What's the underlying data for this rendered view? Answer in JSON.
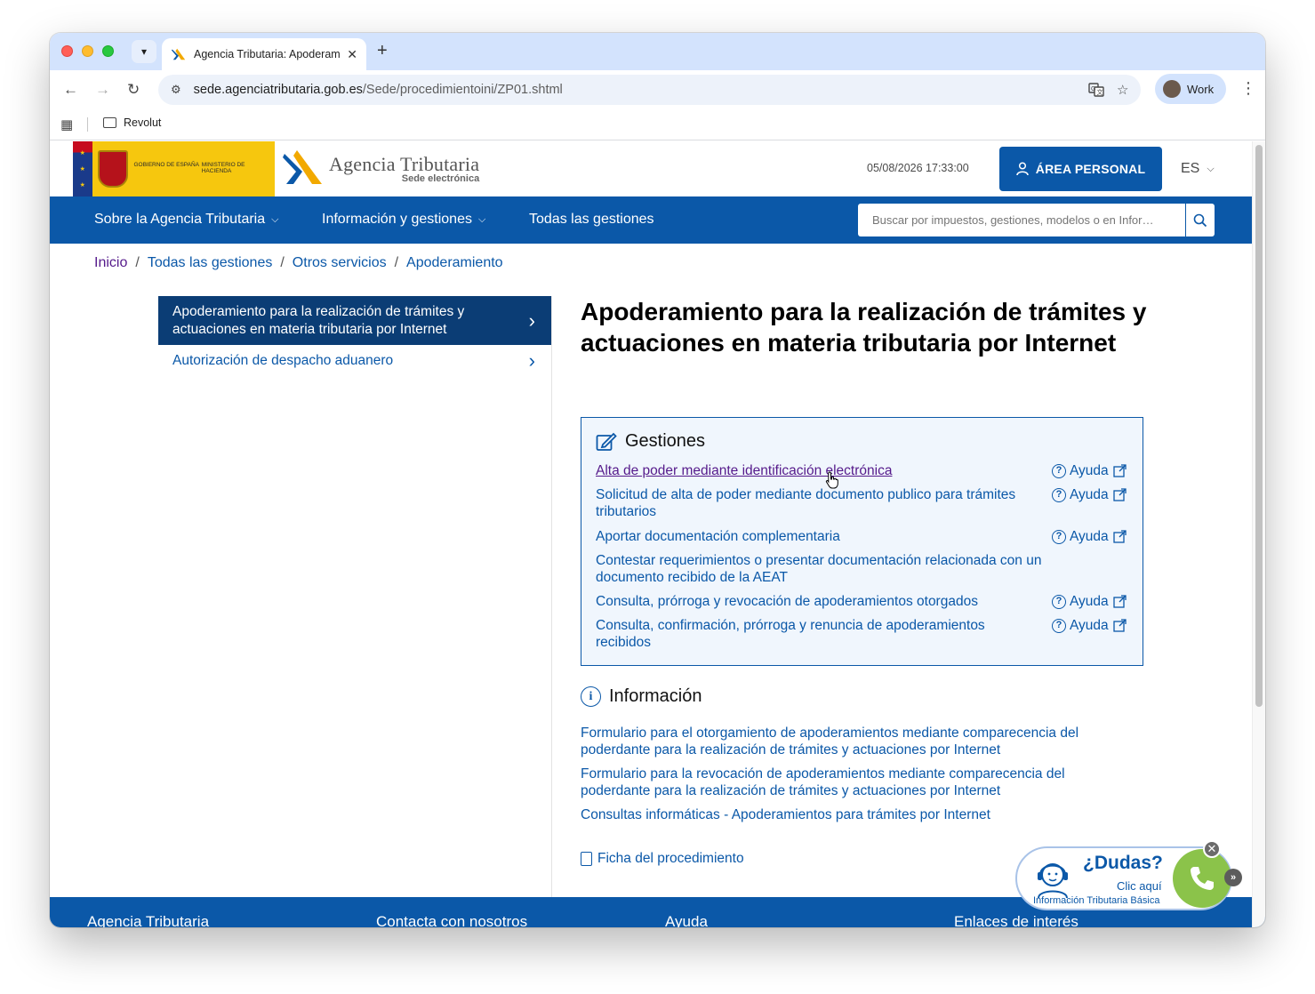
{
  "browser": {
    "tab_title": "Agencia Tributaria: Apoderam",
    "url_domain": "sede.agenciatributaria.gob.es",
    "url_path": "/Sede/procedimientoini/ZP01.shtml",
    "profile_label": "Work",
    "bookmark_folder": "Revolut"
  },
  "header": {
    "gov_text_1": "Gobierno de España",
    "gov_text_2": "Ministerio de Hacienda",
    "brand_name": "Agencia Tributaria",
    "brand_sub": "Sede electrónica",
    "datetime": "05/08/2026 17:33:00",
    "area_personal": "ÁREA PERSONAL",
    "lang": "ES"
  },
  "nav": {
    "items": [
      "Sobre la Agencia Tributaria",
      "Información y gestiones",
      "Todas las gestiones"
    ],
    "search_placeholder": "Buscar por impuestos, gestiones, modelos o en Infor…"
  },
  "breadcrumb": [
    "Inicio",
    "Todas las gestiones",
    "Otros servicios",
    "Apoderamiento"
  ],
  "sidemenu": [
    "Apoderamiento para la realización de trámites y actuaciones en materia tributaria por Internet",
    "Autorización de despacho aduanero"
  ],
  "page_title": "Apoderamiento para la realización de trámites y actuaciones en materia tributaria por Internet",
  "gestiones": {
    "heading": "Gestiones",
    "help_label": "Ayuda",
    "items": [
      {
        "text": "Alta de poder mediante identificación electrónica",
        "has_help": true
      },
      {
        "text": "Solicitud de alta de poder mediante documento publico para trámites tributarios",
        "has_help": true
      },
      {
        "text": "Aportar documentación complementaria",
        "has_help": true
      },
      {
        "text": "Contestar requerimientos o presentar documentación relacionada con un documento recibido de la AEAT",
        "has_help": false
      },
      {
        "text": "Consulta, prórroga y revocación de apoderamientos otorgados",
        "has_help": true
      },
      {
        "text": "Consulta, confirmación, prórroga y renuncia de apoderamientos recibidos",
        "has_help": true
      }
    ]
  },
  "informacion": {
    "heading": "Información",
    "links": [
      "Formulario para el otorgamiento de apoderamientos mediante comparecencia del poderdante para la realización de trámites y actuaciones por Internet",
      "Formulario para la revocación de apoderamientos mediante comparecencia del poderdante para la realización de trámites y actuaciones por Internet",
      "Consultas informáticas - Apoderamientos para trámites por Internet"
    ]
  },
  "ficha": "Ficha del procedimiento",
  "footer": [
    "Agencia Tributaria",
    "Contacta con nosotros",
    "Ayuda",
    "Enlaces de interés"
  ],
  "dudas": {
    "question": "¿Dudas?",
    "cta": "Clic aquí",
    "subtitle": "Información Tributaria Básica"
  },
  "colors": {
    "brand_blue": "#0b58a8",
    "active_menu": "#0b3d75",
    "visited_link": "#551a8b",
    "box_bg": "#f0f6fd"
  }
}
